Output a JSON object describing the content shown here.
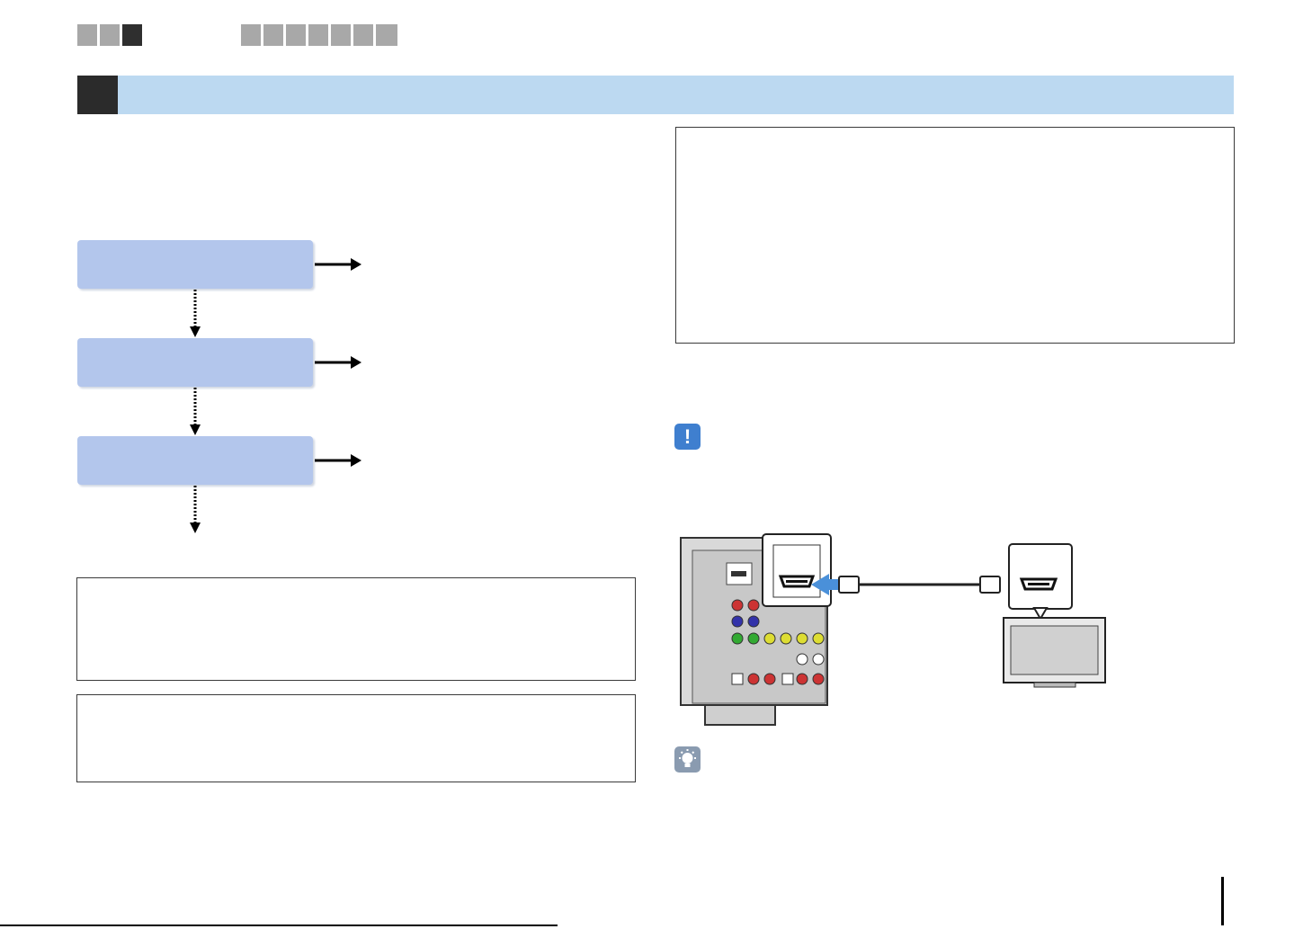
{
  "nav": {
    "left_tabs": 3,
    "right_tabs": 7,
    "active_left_index": 2
  },
  "flow": {
    "steps": 3
  },
  "colors": {
    "header_band": "#bcd9f1",
    "flow_box": "#b3c6ec",
    "caution_icon": "#3f7fcf",
    "hdmi_arrow": "#4a90d9"
  },
  "icons": {
    "caution": "exclamation-icon",
    "hint": "lightbulb-icon"
  },
  "caution_symbol": "!"
}
